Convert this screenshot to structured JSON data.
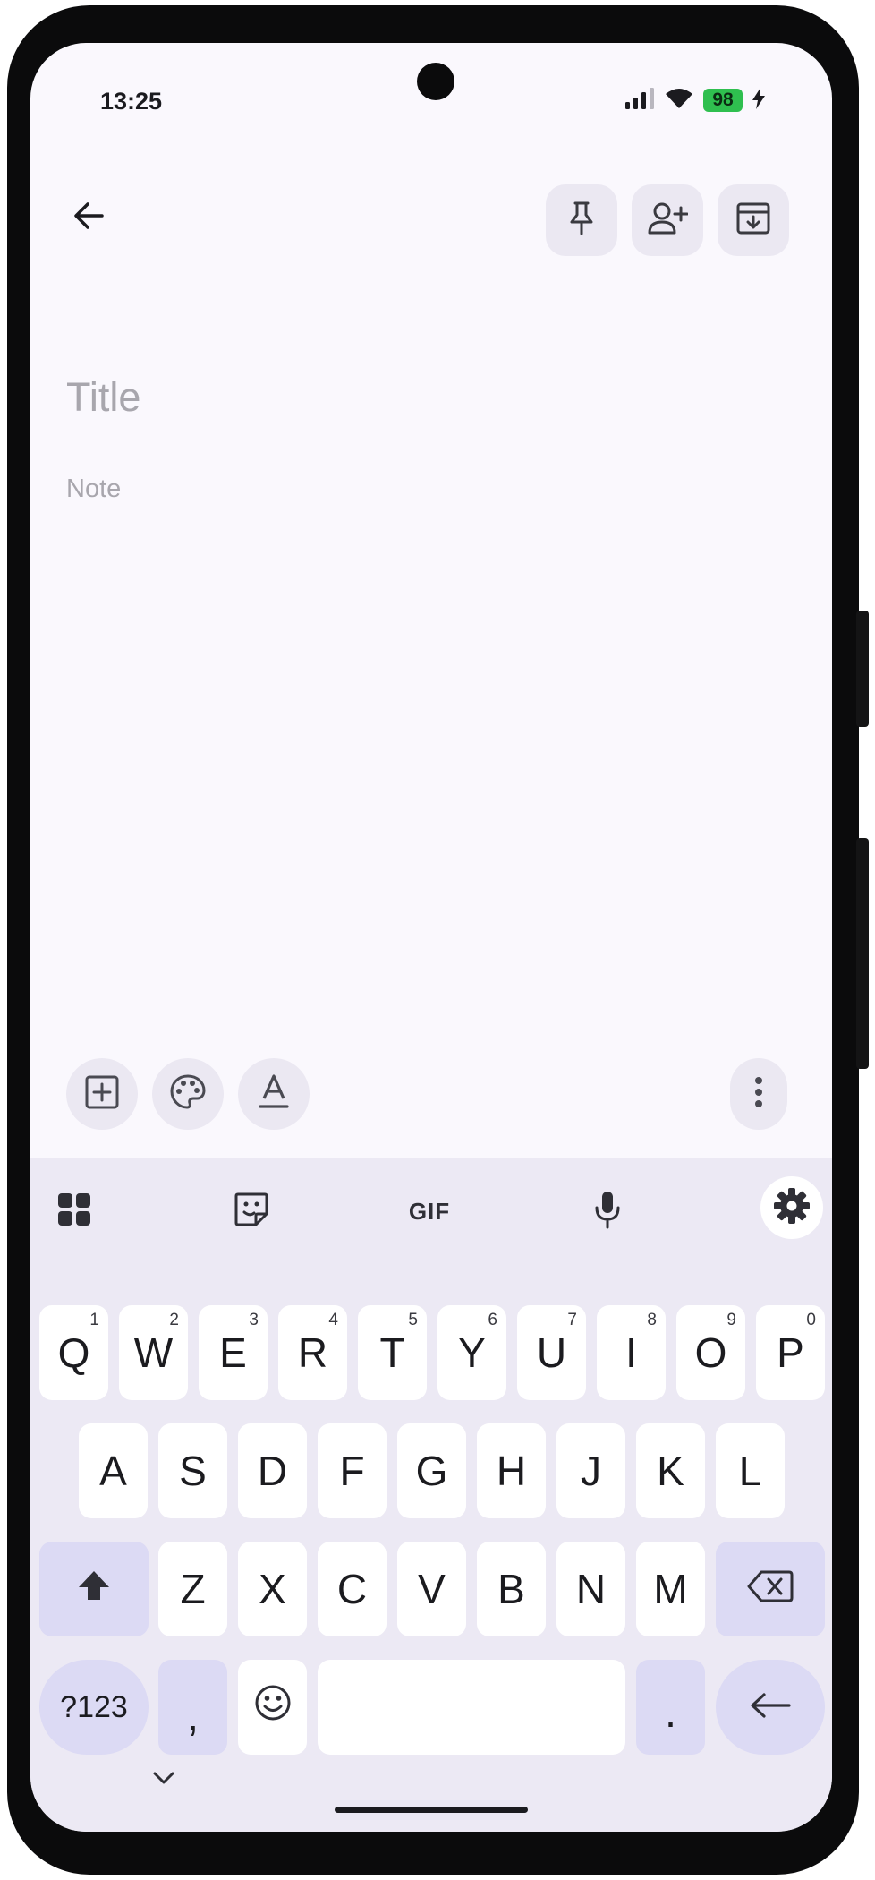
{
  "status_bar": {
    "time": "13:25",
    "battery_level": "98",
    "icons": [
      "signal-icon",
      "wifi-icon",
      "battery-icon",
      "charging-bolt-icon"
    ]
  },
  "toolbar": {
    "back": "back-arrow-icon",
    "actions": [
      "pin-icon",
      "add-collaborator-icon",
      "archive-icon"
    ]
  },
  "note": {
    "title_placeholder": "Title",
    "body_placeholder": "Note",
    "title_value": "",
    "body_value": ""
  },
  "bottom_tools": {
    "items": [
      "add-box-icon",
      "palette-icon",
      "text-format-icon"
    ],
    "more": "more-vert-icon"
  },
  "keyboard": {
    "toolbar": [
      "apps-grid-icon",
      "sticker-icon",
      "gif-icon",
      "microphone-icon",
      "settings-gear-icon"
    ],
    "gif_label": "GIF",
    "row1": [
      {
        "key": "Q",
        "hint": "1"
      },
      {
        "key": "W",
        "hint": "2"
      },
      {
        "key": "E",
        "hint": "3"
      },
      {
        "key": "R",
        "hint": "4"
      },
      {
        "key": "T",
        "hint": "5"
      },
      {
        "key": "Y",
        "hint": "6"
      },
      {
        "key": "U",
        "hint": "7"
      },
      {
        "key": "I",
        "hint": "8"
      },
      {
        "key": "O",
        "hint": "9"
      },
      {
        "key": "P",
        "hint": "0"
      }
    ],
    "row2": [
      "A",
      "S",
      "D",
      "F",
      "G",
      "H",
      "J",
      "K",
      "L"
    ],
    "row3": [
      "Z",
      "X",
      "C",
      "V",
      "B",
      "N",
      "M"
    ],
    "symbols_label": "?123",
    "comma_label": ",",
    "period_label": ".",
    "space_label": ""
  },
  "colors": {
    "screen_bg": "#faf8fd",
    "keyboard_bg": "#ece9f4",
    "special_key": "#dcdaf4",
    "battery": "#2fbf4f"
  }
}
